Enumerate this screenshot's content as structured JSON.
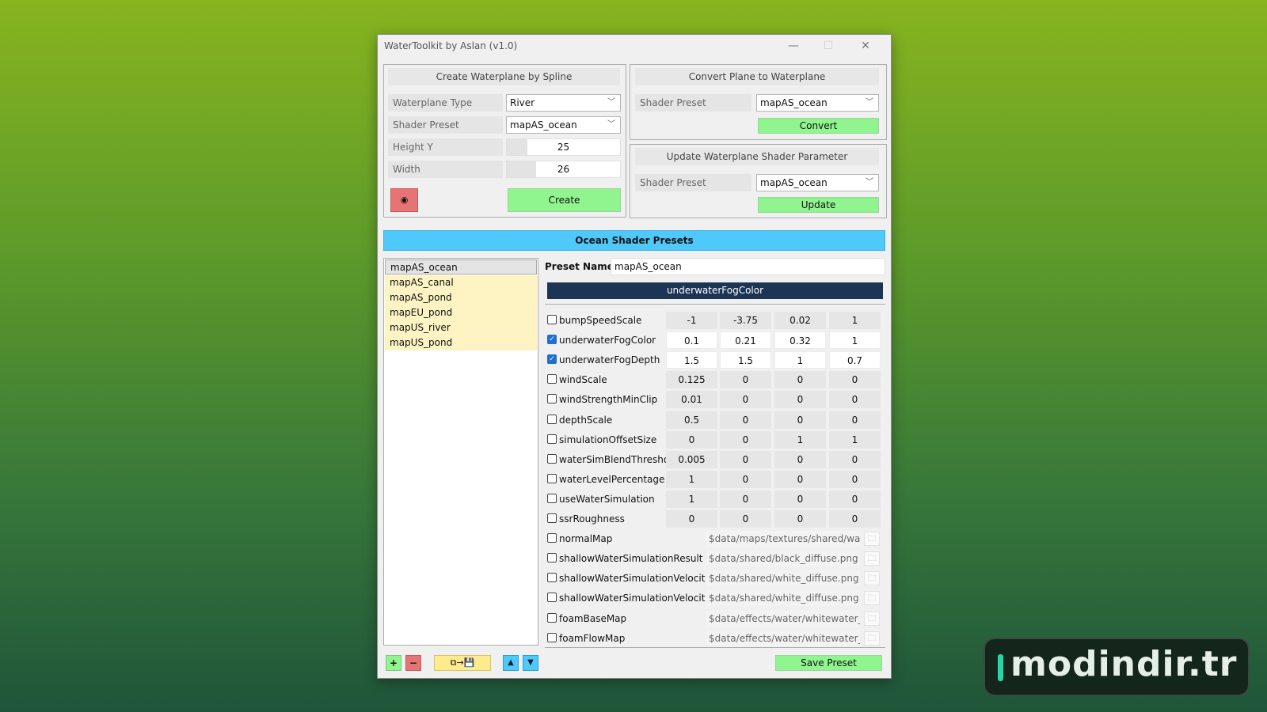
{
  "window": {
    "title": "WaterToolkit by Aslan (v1.0)",
    "controls": {
      "minimize": "—",
      "maximize": "☐",
      "close": "✕"
    }
  },
  "create_group": {
    "header": "Create Waterplane by Spline",
    "waterplane_type_label": "Waterplane Type",
    "waterplane_type_value": "River",
    "shader_preset_label": "Shader Preset",
    "shader_preset_value": "mapAS_ocean",
    "height_label": "Height Y",
    "height_value": "25",
    "height_fill_percent": 18,
    "width_label": "Width",
    "width_value": "26",
    "width_fill_percent": 26,
    "eye_icon": "◉",
    "create_button": "Create"
  },
  "convert_group": {
    "header": "Convert Plane to Waterplane",
    "shader_preset_label": "Shader Preset",
    "shader_preset_value": "mapAS_ocean",
    "convert_button": "Convert"
  },
  "update_group": {
    "header": "Update Waterplane Shader Parameter",
    "shader_preset_label": "Shader Preset",
    "shader_preset_value": "mapAS_ocean",
    "update_button": "Update"
  },
  "presets_banner": "Ocean Shader Presets",
  "preset_list": [
    "mapAS_ocean",
    "mapAS_canal",
    "mapAS_pond",
    "mapEU_pond",
    "mapUS_river",
    "mapUS_pond"
  ],
  "preset_name_label": "Preset Name",
  "preset_name_value": "mapAS_ocean",
  "color_swatch_label": "underwaterFogColor",
  "color_swatch_hex": "#1d3554",
  "params": [
    {
      "name": "bumpSpeedScale",
      "checked": false,
      "values": [
        "-1",
        "-3.75",
        "0.02",
        "1"
      ]
    },
    {
      "name": "underwaterFogColor",
      "checked": true,
      "values": [
        "0.1",
        "0.21",
        "0.32",
        "1"
      ]
    },
    {
      "name": "underwaterFogDepth",
      "checked": true,
      "values": [
        "1.5",
        "1.5",
        "1",
        "0.7"
      ]
    },
    {
      "name": "windScale",
      "checked": false,
      "values": [
        "0.125",
        "0",
        "0",
        "0"
      ]
    },
    {
      "name": "windStrengthMinClip",
      "checked": false,
      "values": [
        "0.01",
        "0",
        "0",
        "0"
      ]
    },
    {
      "name": "depthScale",
      "checked": false,
      "values": [
        "0.5",
        "0",
        "0",
        "0"
      ]
    },
    {
      "name": "simulationOffsetSize",
      "checked": false,
      "values": [
        "0",
        "0",
        "1",
        "1"
      ]
    },
    {
      "name": "waterSimBlendThreshold",
      "checked": false,
      "values": [
        "0.005",
        "0",
        "0",
        "0"
      ]
    },
    {
      "name": "waterLevelPercentage",
      "checked": false,
      "values": [
        "1",
        "0",
        "0",
        "0"
      ]
    },
    {
      "name": "useWaterSimulation",
      "checked": false,
      "values": [
        "1",
        "0",
        "0",
        "0"
      ]
    },
    {
      "name": "ssrRoughness",
      "checked": false,
      "values": [
        "0",
        "0",
        "0",
        "0"
      ]
    }
  ],
  "textures": [
    {
      "name": "normalMap",
      "checked": false,
      "path": "$data/maps/textures/shared/water_r"
    },
    {
      "name": "shallowWaterSimulationResult",
      "checked": false,
      "path": "$data/shared/black_diffuse.png"
    },
    {
      "name": "shallowWaterSimulationVelocityU",
      "checked": false,
      "path": "$data/shared/white_diffuse.png"
    },
    {
      "name": "shallowWaterSimulationVelocityV",
      "checked": false,
      "path": "$data/shared/white_diffuse.png"
    },
    {
      "name": "foamBaseMap",
      "checked": false,
      "path": "$data/effects/water/whitewater_diffu"
    },
    {
      "name": "foamFlowMap",
      "checked": false,
      "path": "$data/effects/water/whitewater_flow"
    }
  ],
  "folder_icon": "🗀",
  "bottom_buttons": {
    "add": "+",
    "remove": "−",
    "copy_save": "⧉→💾",
    "move_up": "▲",
    "move_down": "▼",
    "save_preset": "Save Preset"
  },
  "watermark": "modindir.tr"
}
